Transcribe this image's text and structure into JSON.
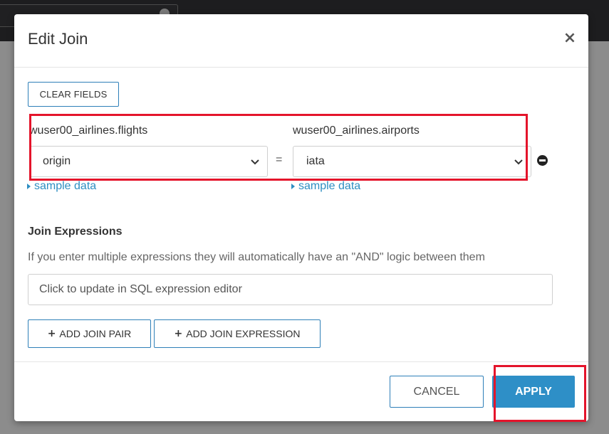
{
  "dialog": {
    "title": "Edit Join",
    "close_glyph": "×"
  },
  "toolbar": {
    "clear_fields_label": "CLEAR FIELDS"
  },
  "join_pair": {
    "left_table": "wuser00_airlines.flights",
    "right_table": "wuser00_airlines.airports",
    "left_column": "origin",
    "right_column": "iata",
    "operator": "=",
    "left_sample_label": "sample data",
    "right_sample_label": "sample data"
  },
  "expressions": {
    "title": "Join Expressions",
    "description": "If you enter multiple expressions they will automatically have an \"AND\" logic between them",
    "placeholder": "Click to update in SQL expression editor"
  },
  "actions": {
    "add_pair_label": "ADD JOIN PAIR",
    "add_expression_label": "ADD JOIN EXPRESSION",
    "plus_glyph": "+"
  },
  "footer": {
    "cancel_label": "CANCEL",
    "apply_label": "APPLY"
  },
  "icons": {
    "close": "close-icon",
    "chevron": "chevron-down-icon",
    "remove": "minus-circle-icon",
    "caret": "caret-right-icon",
    "plus": "plus-icon"
  },
  "colors": {
    "accent": "#2e8fc7",
    "highlight": "#e4142b",
    "link": "#2e8ec2"
  }
}
